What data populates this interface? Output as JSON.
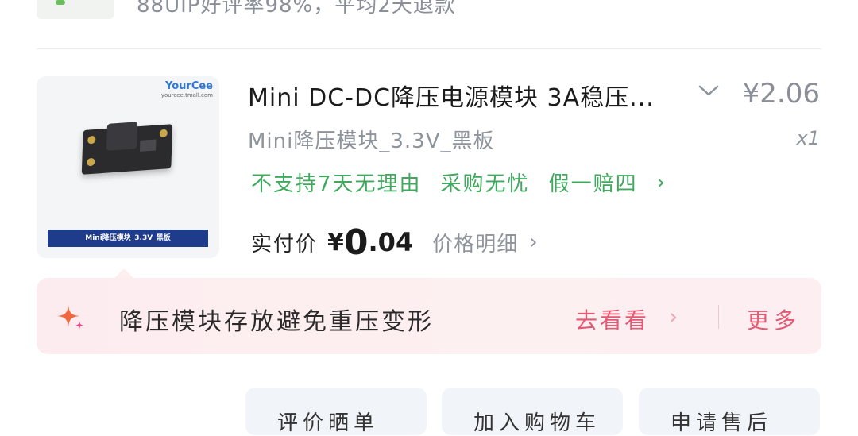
{
  "previous_item": {
    "info_line": "88UIP好评率98%，平均2天退款"
  },
  "product": {
    "image": {
      "brand_name": "YourCee",
      "brand_site": "yourcee.tmall.com",
      "caption": "Mini降压模块_3.3V_黑板"
    },
    "title": "Mini DC-DC降压电源模块 3A稳压...",
    "unit_price": "¥2.06",
    "variant": "Mini降压模块_3.3V_黑板",
    "quantity": "x1",
    "policies": [
      "不支持7天无理由",
      "采购无忧",
      "假一赔四"
    ],
    "paid_label": "实付价",
    "paid_currency": "¥",
    "paid_integer": "0",
    "paid_decimal": ".04",
    "price_detail_label": "价格明细"
  },
  "tip": {
    "text": "降压模块存放避免重压变形",
    "go_label": "去看看",
    "more_label": "更多"
  },
  "bottom_buttons": [
    "评价晒单",
    "加入购物车",
    "申请售后"
  ],
  "colors": {
    "policy_green": "#3faa5e",
    "tip_accent": "#e25a73",
    "price_grey": "#8b8e97"
  }
}
